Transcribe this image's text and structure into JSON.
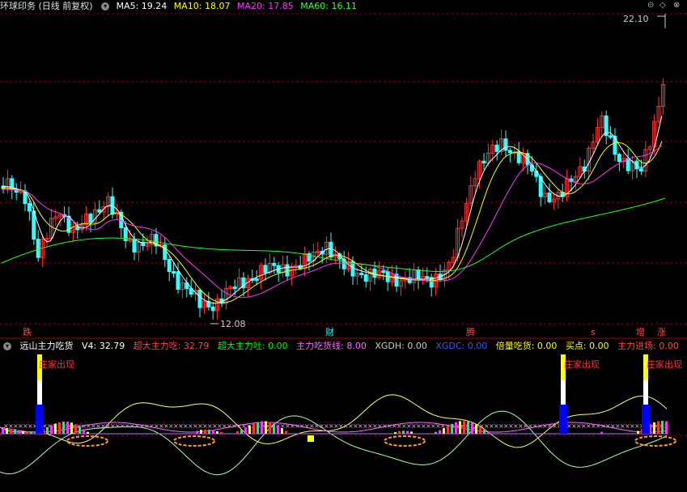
{
  "main": {
    "title": "环球印务 (日线 前复权)",
    "ma": [
      {
        "label": "MA5: 19.24",
        "color": "#ffffff"
      },
      {
        "label": "MA10: 18.07",
        "color": "#ffff00"
      },
      {
        "label": "MA20: 17.85",
        "color": "#ff00ff"
      },
      {
        "label": "MA60: 16.11",
        "color": "#00ff00"
      }
    ],
    "high_label": "22.10",
    "low_label": "12.08",
    "markers": [
      {
        "text": "跌",
        "color": "#ff4444"
      },
      {
        "text": "财",
        "color": "#00ffff"
      },
      {
        "text": "腾",
        "color": "#ff4444"
      },
      {
        "text": "s",
        "color": "#ff4444"
      },
      {
        "text": "增",
        "color": "#ff4444"
      },
      {
        "text": "涨",
        "color": "#ff4444"
      }
    ],
    "colors": {
      "up": "#ff3333",
      "down": "#33ffff",
      "grid": "#880000"
    }
  },
  "sub": {
    "name": "远山主力吃货",
    "legend": [
      {
        "label": "V4: 32.79",
        "color": "#ffffff"
      },
      {
        "label": "超大主力吃: 32.79",
        "color": "#ff4444"
      },
      {
        "label": "超大主力吐: 0.00",
        "color": "#00ff00"
      },
      {
        "label": "主力吃货线: 8.00",
        "color": "#ff66ff"
      },
      {
        "label": "XGDH: 0.00",
        "color": "#cccccc"
      },
      {
        "label": "XGDC: 0.00",
        "color": "#0000ff"
      },
      {
        "label": "倍量吃货: 0.00",
        "color": "#ffff00"
      },
      {
        "label": "买点: 0.00",
        "color": "#ffff00"
      },
      {
        "label": "主力进场: 0.00",
        "color": "#ff4444"
      }
    ],
    "signal_text": "庄家出现"
  }
}
